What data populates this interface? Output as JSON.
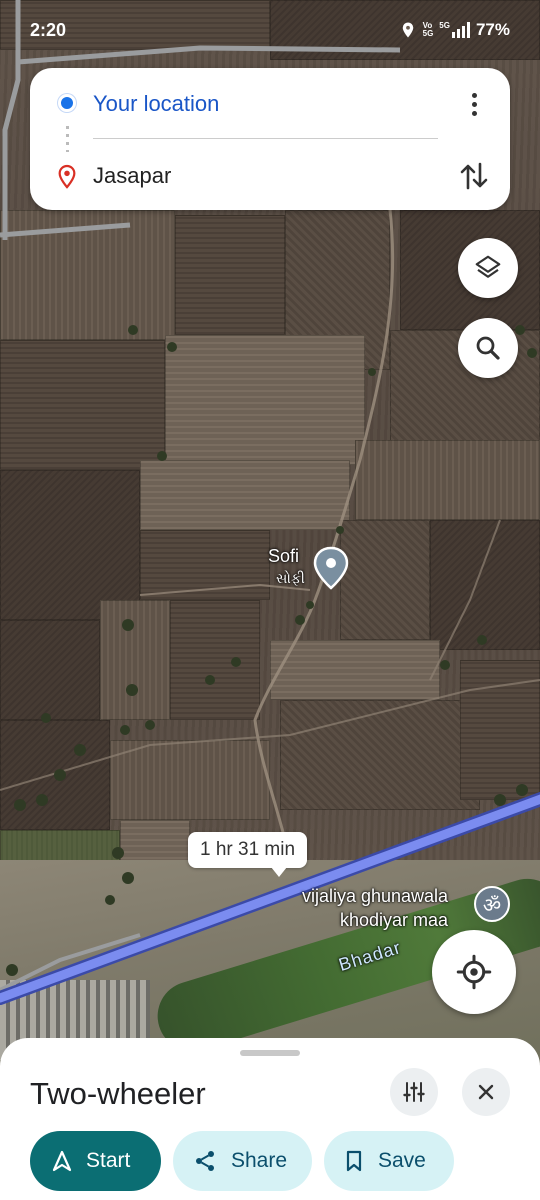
{
  "status_bar": {
    "time": "2:20",
    "volte_top": "Vo",
    "volte_bottom": "5G",
    "network": "5G",
    "battery": "77%"
  },
  "route_card": {
    "origin": "Your location",
    "destination": "Jasapar",
    "icons": {
      "origin": "location-dot-icon",
      "destination": "red-pin-icon",
      "more": "more-vert-icon",
      "swap": "swap-vert-icon"
    }
  },
  "map": {
    "place": {
      "name": "Sofi",
      "local_name": "સોફી"
    },
    "temple": {
      "line1": "vijaliya ghunawala",
      "line2": "khodiyar maa",
      "icon_glyph": "ॐ"
    },
    "river": "Bhadar",
    "eta": "1 hr 31 min",
    "route_color": "#7b8cf0",
    "controls": {
      "layers": "layers-icon",
      "search": "search-icon",
      "locate": "my-location-icon"
    }
  },
  "sheet": {
    "title": "Two-wheeler",
    "start": "Start",
    "share": "Share",
    "save": "Save",
    "accent": "#0b6e73"
  }
}
